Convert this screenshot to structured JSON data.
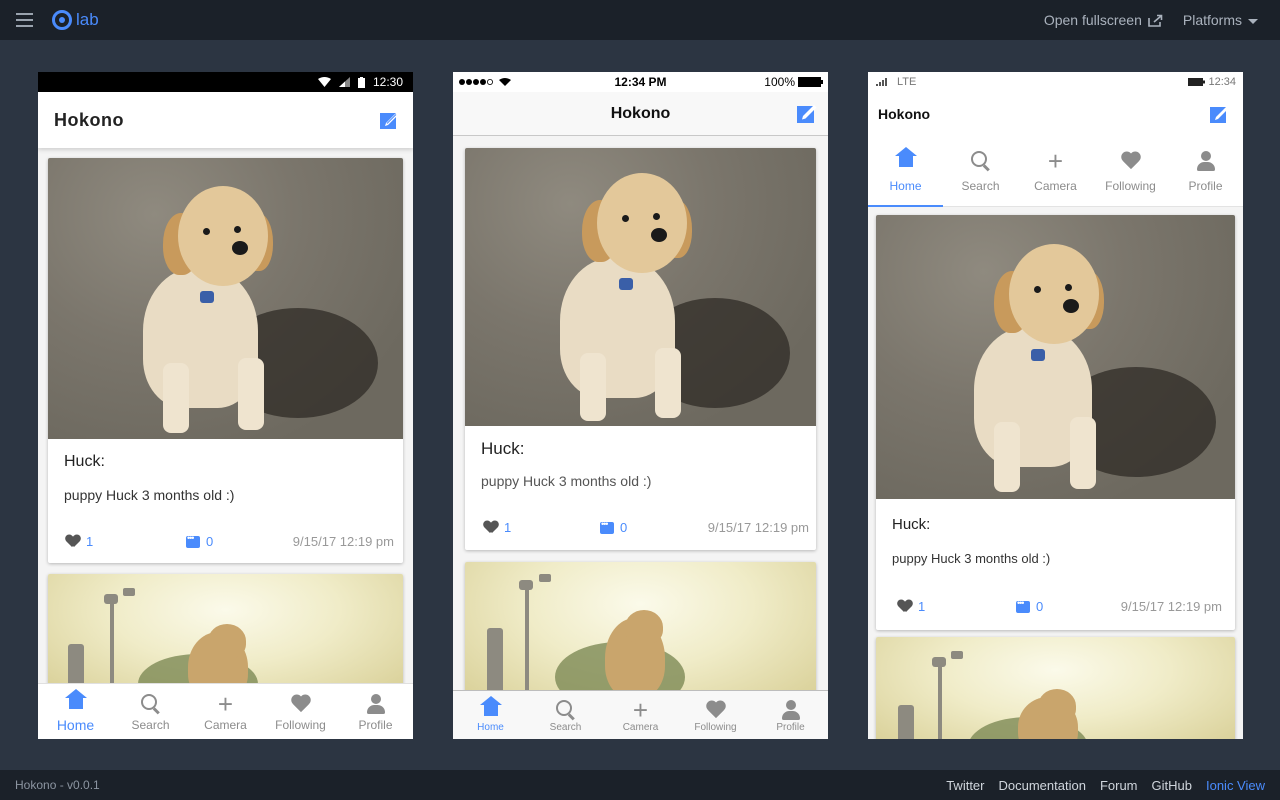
{
  "topbar": {
    "logo_text": "lab",
    "open_fullscreen": "Open fullscreen",
    "platforms": "Platforms"
  },
  "footer": {
    "version": "Hokono - v0.0.1",
    "links": [
      "Twitter",
      "Documentation",
      "Forum",
      "GitHub",
      "Ionic View"
    ],
    "active_link": "Ionic View"
  },
  "app": {
    "title": "Hokono",
    "post": {
      "name": "Huck:",
      "text": "puppy Huck 3 months old :)",
      "likes": "1",
      "comments": "0",
      "time": "9/15/17 12:19 pm"
    },
    "tabs": [
      "Home",
      "Search",
      "Camera",
      "Following",
      "Profile"
    ],
    "active_tab": "Home"
  },
  "android": {
    "time": "12:30"
  },
  "ios": {
    "time": "12:34 PM",
    "battery": "100%"
  },
  "windows": {
    "network": "LTE",
    "time": "12:34"
  },
  "colors": {
    "accent": "#4a8bfc",
    "chrome": "#1b2129",
    "stage": "#2c3542"
  }
}
